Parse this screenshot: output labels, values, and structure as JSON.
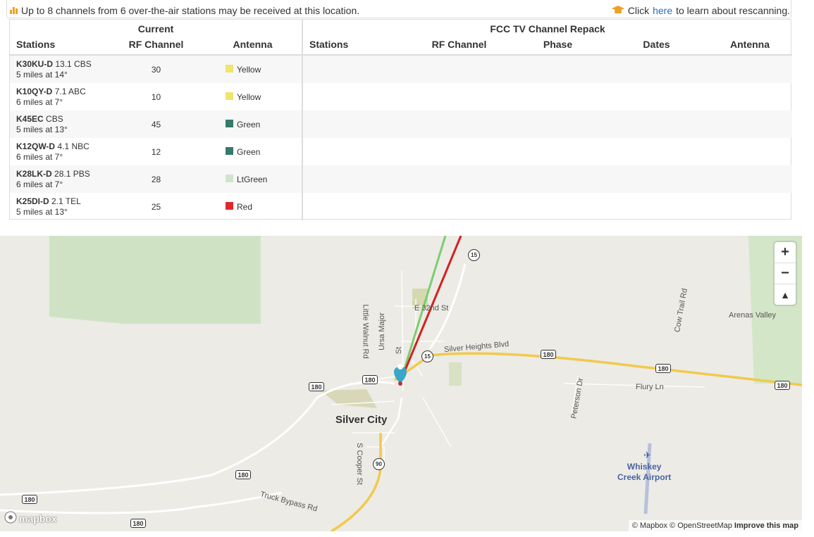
{
  "notice": {
    "left_icon": "bar-chart-icon",
    "text": "Up to 8 channels from 6 over-the-air stations may be received at this location.",
    "right_icon": "graduation-cap-icon",
    "click_text": "Click",
    "link_text": "here",
    "after_link": "to learn about rescanning."
  },
  "table": {
    "current_group": "Current",
    "repack_group": "FCC TV Channel Repack",
    "headers": {
      "stations": "Stations",
      "rf_channel": "RF Channel",
      "antenna": "Antenna",
      "repack_stations": "Stations",
      "repack_rf_channel": "RF Channel",
      "phase": "Phase",
      "dates": "Dates",
      "repack_antenna": "Antenna"
    },
    "rows": [
      {
        "callsign": "K30KU-D",
        "channel_net": "13.1 CBS",
        "distance": "5 miles at 14°",
        "rf": "30",
        "antenna": "Yellow",
        "color": "#f0e36e"
      },
      {
        "callsign": "K10QY-D",
        "channel_net": "7.1 ABC",
        "distance": "6 miles at 7°",
        "rf": "10",
        "antenna": "Yellow",
        "color": "#f0e36e"
      },
      {
        "callsign": "K45EC",
        "channel_net": "CBS",
        "distance": "5 miles at 13°",
        "rf": "45",
        "antenna": "Green",
        "color": "#357a6b"
      },
      {
        "callsign": "K12QW-D",
        "channel_net": "4.1 NBC",
        "distance": "6 miles at 7°",
        "rf": "12",
        "antenna": "Green",
        "color": "#357a6b"
      },
      {
        "callsign": "K28LK-D",
        "channel_net": "28.1 PBS",
        "distance": "6 miles at 7°",
        "rf": "28",
        "antenna": "LtGreen",
        "color": "#cfe4cf"
      },
      {
        "callsign": "K25DI-D",
        "channel_net": "2.1 TEL",
        "distance": "5 miles at 13°",
        "rf": "25",
        "antenna": "Red",
        "color": "#e02a2a"
      }
    ]
  },
  "map": {
    "city": "Silver City",
    "airport_line1": "Whiskey",
    "airport_line2": "Creek Airport",
    "labels": {
      "arenas_valley": "Arenas Valley",
      "silver_heights": "Silver Heights Blvd",
      "flury": "Flury Ln",
      "peterson": "Peterson Dr",
      "cow_trail": "Cow Trail Rd",
      "little_walnut": "Little Walnut Rd",
      "ursa_major": "Ursa Major",
      "e32nd": "E 32nd St",
      "hudson": "St",
      "cooper": "S Cooper St",
      "truck_bypass": "Truck Bypass Rd"
    },
    "shields": {
      "us180": "180",
      "nm15": "15",
      "nm90": "90"
    },
    "zoom_in": "+",
    "zoom_out": "−",
    "compass": "▲",
    "logo": "mapbox",
    "attribution": "© Mapbox © OpenStreetMap",
    "improve": "Improve this map"
  }
}
